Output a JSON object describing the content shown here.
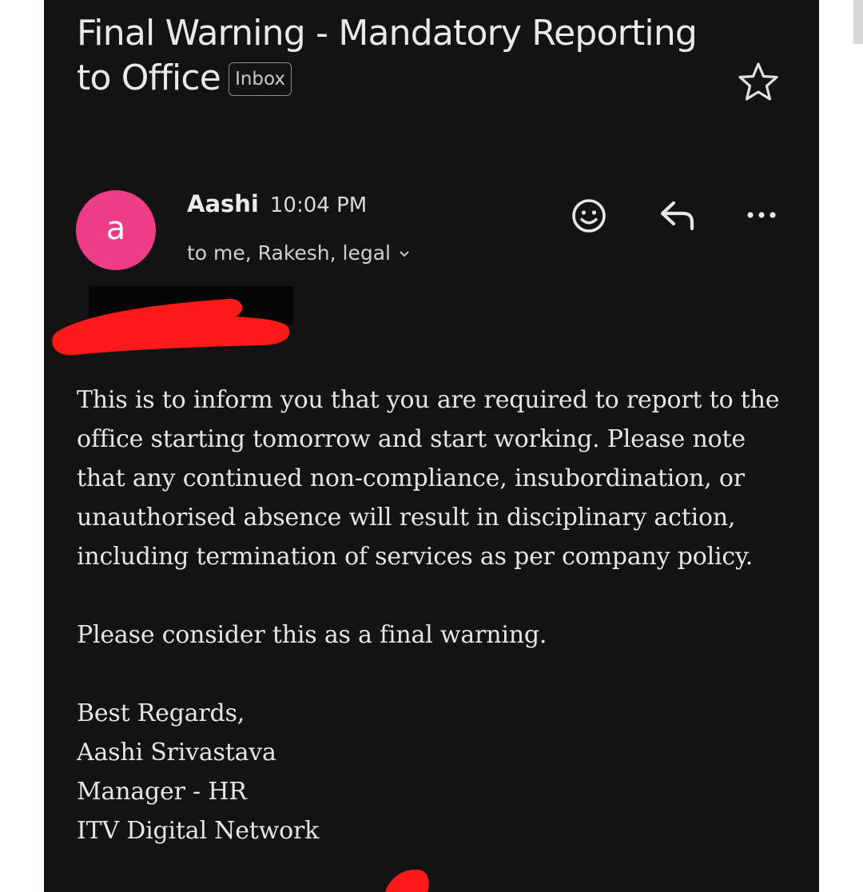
{
  "email": {
    "subject": "Final Warning - Mandatory Reporting to Office",
    "label": "Inbox",
    "sender": {
      "avatar_letter": "a",
      "name": "Aashi",
      "time": "10:04 PM",
      "recipients": "to me, Rakesh, legal",
      "avatar_color": "#ee3d87"
    },
    "body": {
      "paragraph_1": "This is to inform you that you are required to report to the office starting tomorrow and start working. Please note that any continued non-compliance, insubordination, or unauthorised absence will result in disciplinary action, including termination of services as per company policy.",
      "paragraph_2": "Please consider this as a final warning."
    },
    "signature": {
      "closing": "Best Regards,",
      "name": "Aashi Srivastava",
      "title": "Manager - HR",
      "company": "ITV Digital Network"
    }
  },
  "icons": {
    "star": "star-outline-icon",
    "emoji": "emoji-reaction-icon",
    "reply": "reply-icon",
    "more": "more-options-icon",
    "caret": "chevron-down-icon"
  },
  "colors": {
    "background": "#131313",
    "text": "#e9e9e9",
    "redaction": "#ff1a1a"
  }
}
